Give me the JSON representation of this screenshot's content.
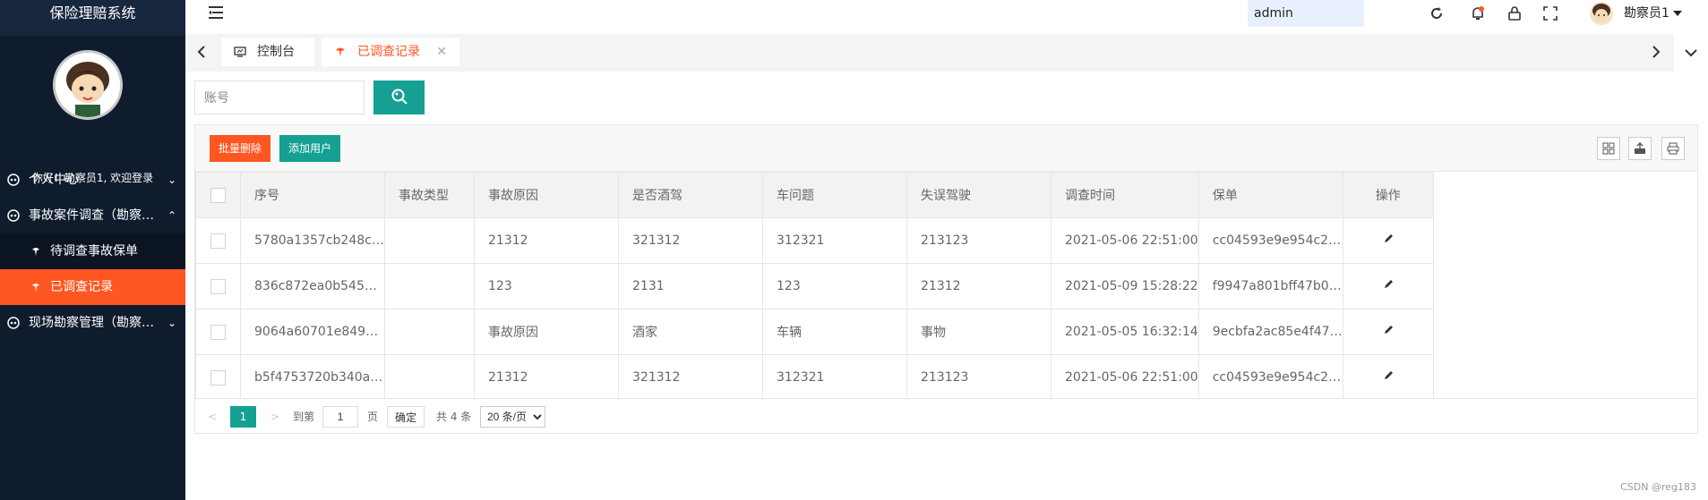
{
  "sidebar": {
    "logo_text": "保险理赔系统",
    "welcome": "你好！勘察员1, 欢迎登录",
    "menu": [
      {
        "label": "个人中心",
        "expanded": false
      },
      {
        "label": "事故案件调查（勘察员）",
        "expanded": true
      },
      {
        "label": "待调查事故保单"
      },
      {
        "label": "已调查记录",
        "active": true
      },
      {
        "label": "现场勘察管理（勘察员）",
        "expanded": false
      }
    ]
  },
  "header": {
    "admin_input_value": "admin",
    "user_name": "勘察员1"
  },
  "tabs": [
    {
      "label": "控制台",
      "active": false
    },
    {
      "label": "已调查记录",
      "active": true
    }
  ],
  "search": {
    "placeholder": "账号"
  },
  "toolbar": {
    "batch_delete": "批量删除",
    "add_user": "添加用户"
  },
  "table": {
    "columns": [
      "序号",
      "事故类型",
      "事故原因",
      "是否酒驾",
      "车问题",
      "失误驾驶",
      "调查时间",
      "保单",
      "操作"
    ],
    "rows": [
      [
        "5780a1357cb248c…",
        "",
        "21312",
        "321312",
        "312321",
        "213123",
        "2021-05-06 22:51:00",
        "cc04593e9e954c2…"
      ],
      [
        "836c872ea0b545…",
        "",
        "123",
        "2131",
        "123",
        "21312",
        "2021-05-09 15:28:22",
        "f9947a801bff47b0…"
      ],
      [
        "9064a60701e849…",
        "",
        "事故原因",
        "酒家",
        "车辆",
        "事物",
        "2021-05-05 16:32:14",
        "9ecbfa2ac85e4f47…"
      ],
      [
        "b5f4753720b340a…",
        "",
        "21312",
        "321312",
        "312321",
        "213123",
        "2021-05-06 22:51:00",
        "cc04593e9e954c2…"
      ]
    ]
  },
  "pagination": {
    "current_page": "1",
    "goto_label": "到第",
    "goto_value": "1",
    "page_label": "页",
    "confirm": "确定",
    "total": "共 4 条",
    "page_size": "20 条/页"
  },
  "footer": {
    "watermark": "CSDN @reg183"
  },
  "colors": {
    "sidebar_bg": "#0f1c2e",
    "accent_orange": "#ff5722",
    "accent_green": "#16a094"
  }
}
